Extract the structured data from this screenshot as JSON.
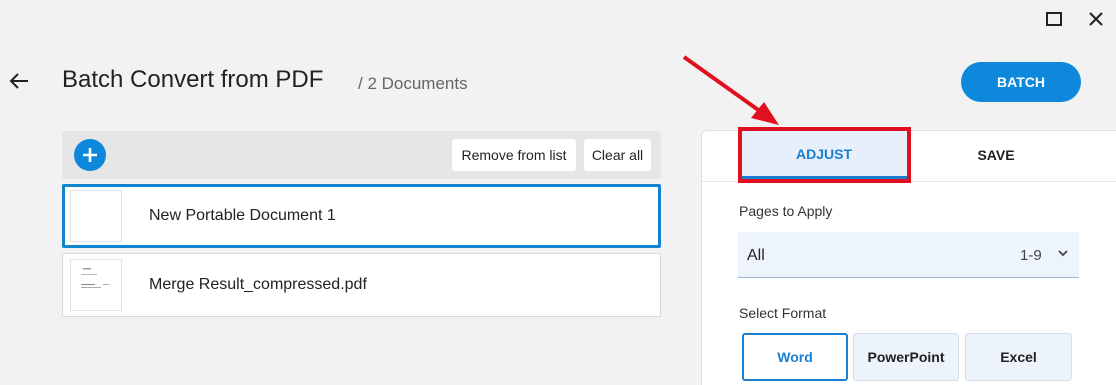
{
  "window": {
    "maximize_icon": "maximize-icon",
    "close_icon": "close-icon"
  },
  "header": {
    "title": "Batch Convert from PDF",
    "subtitle": "/ 2 Documents",
    "batch_label": "BATCH"
  },
  "toolbar": {
    "remove_label": "Remove from list",
    "clear_label": "Clear all"
  },
  "documents": [
    {
      "name": "New Portable Document 1",
      "selected": true
    },
    {
      "name": "Merge Result_compressed.pdf",
      "selected": false
    }
  ],
  "panel": {
    "tabs": [
      {
        "label": "ADJUST",
        "active": true
      },
      {
        "label": "SAVE",
        "active": false
      }
    ],
    "pages_label": "Pages to Apply",
    "pages_value": "All",
    "pages_range": "1-9",
    "format_label": "Select Format",
    "formats": [
      {
        "label": "Word",
        "selected": true
      },
      {
        "label": "PowerPoint",
        "selected": false
      },
      {
        "label": "Excel",
        "selected": false
      }
    ]
  },
  "colors": {
    "accent": "#0e88da",
    "annotation": "#e01020",
    "background": "#f2f2f2"
  }
}
